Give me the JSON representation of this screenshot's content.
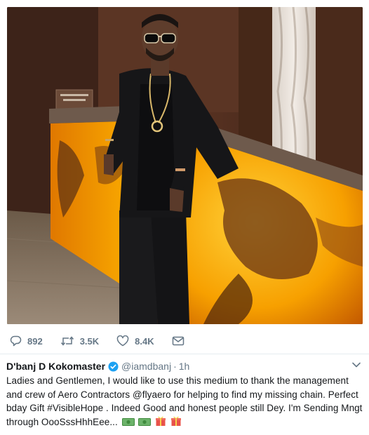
{
  "tweet": {
    "photo_alt": "Man in sunglasses and black outfit leaning on an illuminated onyx reception counter",
    "actions": {
      "replies": "892",
      "retweets": "3.5K",
      "likes": "8.4K"
    },
    "author": {
      "display_name": "D'banj D Kokomaster",
      "handle": "@iamdbanj",
      "separator": "·",
      "time": "1h"
    },
    "text": "Ladies and Gentlemen, I would like to use this medium to thank the management and crew of Aero Contractors @flyaero for helping to find my missing chain. Perfect bday Gift #VisibleHope . Indeed Good and honest people still Dey. I'm Sending Mngt through OooSssHhhEee..."
  },
  "colors": {
    "icon_gray": "#657786",
    "verified_blue": "#1da1f2",
    "text": "#14171a",
    "divider": "#e6ecf0"
  },
  "icons": [
    "reply-icon",
    "retweet-icon",
    "like-icon",
    "dm-icon",
    "verified-icon",
    "chevron-down-icon",
    "money-emoji",
    "gift-emoji"
  ]
}
